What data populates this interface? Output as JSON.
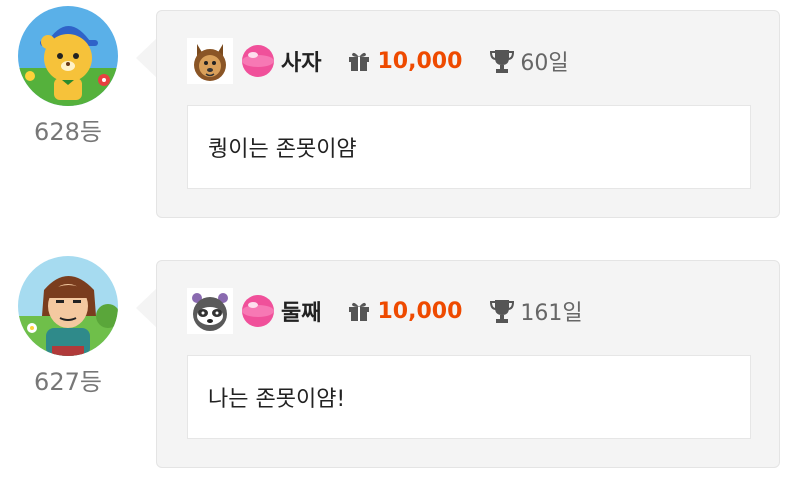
{
  "comments": [
    {
      "rank": "628등",
      "nickname": "사자",
      "points": "10,000",
      "days": "60일",
      "message": "퀑이는 존못이얌",
      "avatar_icon": "lion-avatar",
      "badge_icon": "lion-badge-icon"
    },
    {
      "rank": "627등",
      "nickname": "둘째",
      "points": "10,000",
      "days": "161일",
      "message": "나는 존못이얌!",
      "avatar_icon": "boy-avatar",
      "badge_icon": "raccoon-badge-icon"
    }
  ],
  "colors": {
    "points": "#ee4a00",
    "card_bg": "#f4f4f4",
    "rank_text": "#777777",
    "gem": "#f0509a"
  }
}
